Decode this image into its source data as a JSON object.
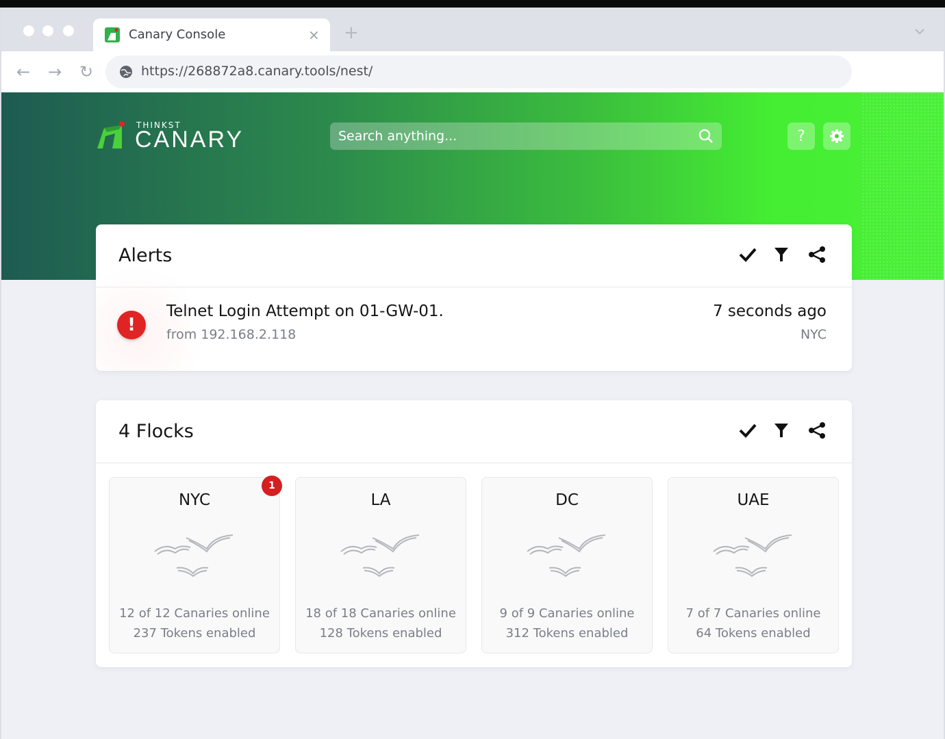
{
  "browser": {
    "tab_title": "Canary Console",
    "tab_close": "×",
    "new_tab": "+",
    "url": "https://268872a8.canary.tools/nest/",
    "back": "←",
    "forward": "→",
    "reload": "↻"
  },
  "header": {
    "logo_small": "THINKST",
    "logo_big": "CANARY",
    "search_placeholder": "Search anything...",
    "help": "?",
    "colors": {
      "brand_green": "#4af038",
      "brand_dark": "#1e5b52"
    }
  },
  "alerts": {
    "title": "Alerts",
    "actions": [
      "check-icon",
      "filter-icon",
      "share-icon"
    ],
    "items": [
      {
        "icon": "!",
        "title": "Telnet Login Attempt on 01-GW-01.",
        "from": "from 192.168.2.118",
        "time": "7 seconds ago",
        "location": "NYC"
      }
    ]
  },
  "flocks": {
    "title": "4 Flocks",
    "actions": [
      "check-icon",
      "filter-icon",
      "share-icon"
    ],
    "items": [
      {
        "name": "NYC",
        "canaries": "12 of 12 Canaries online",
        "tokens": "237 Tokens enabled",
        "badge": "1"
      },
      {
        "name": "LA",
        "canaries": "18 of 18 Canaries online",
        "tokens": "128 Tokens enabled"
      },
      {
        "name": "DC",
        "canaries": "9 of 9 Canaries online",
        "tokens": "312 Tokens enabled"
      },
      {
        "name": "UAE",
        "canaries": "7 of 7 Canaries online",
        "tokens": "64 Tokens enabled"
      }
    ]
  }
}
